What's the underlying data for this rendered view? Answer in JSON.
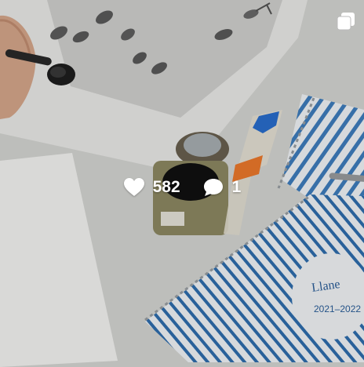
{
  "post": {
    "likes_count": "582",
    "comments_count": "1",
    "icons": {
      "like": "heart-icon",
      "comment": "comment-bubble-icon",
      "carousel": "multiple-images-icon"
    },
    "photo_text": {
      "notebook_year": "2021–2022"
    }
  },
  "colors": {
    "overlay_text": "#ffffff",
    "notebook_blue": "#2f6fb0"
  }
}
